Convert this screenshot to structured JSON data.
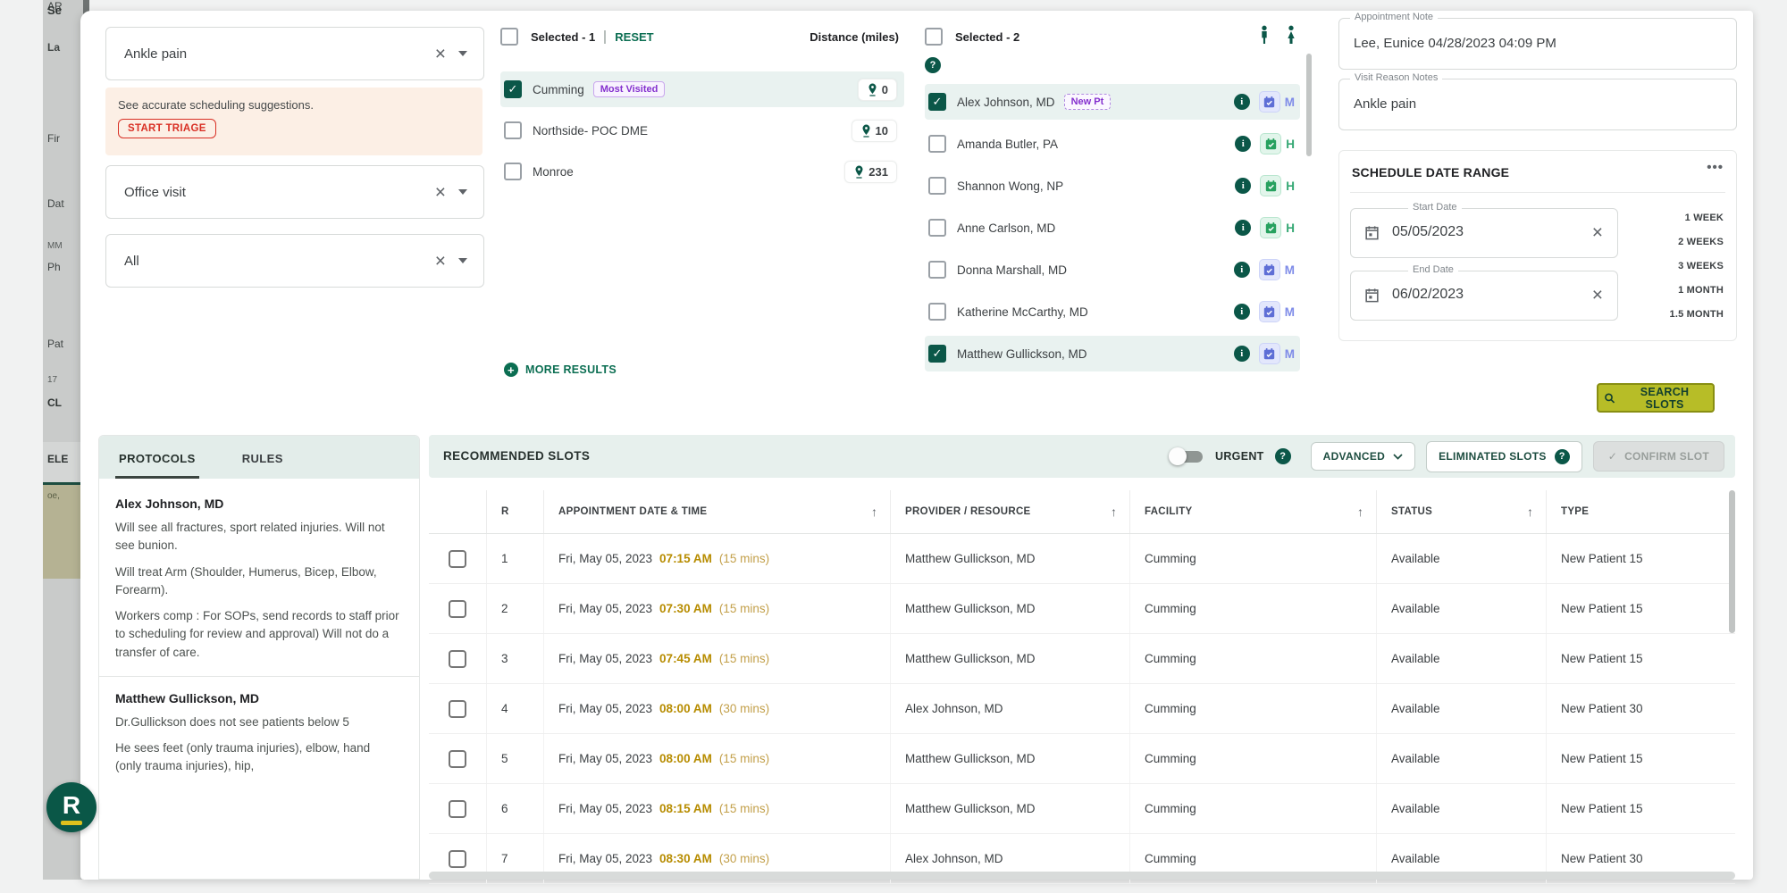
{
  "background": {
    "fragments": [
      "AR",
      "Se",
      "La",
      "Fir",
      "Dat",
      "MM",
      "Ph",
      "Pat",
      "17",
      "CL",
      "ELE",
      "oe,"
    ]
  },
  "filters": {
    "visit_reason": "Ankle pain",
    "appointment_type": "Office visit",
    "provider_filter": "All",
    "triage_notice": "See accurate scheduling suggestions.",
    "triage_button": "START TRIAGE"
  },
  "facilities": {
    "selected_label": "Selected - 1",
    "reset_label": "RESET",
    "distance_header": "Distance (miles)",
    "more_results": "MORE RESULTS",
    "items": [
      {
        "name": "Cumming",
        "badge": "Most Visited",
        "distance": "0",
        "state": "checked",
        "row_class": "selected"
      },
      {
        "name": "Northside- POC DME",
        "badge": "",
        "distance": "10",
        "state": "",
        "row_class": ""
      },
      {
        "name": "Monroe",
        "badge": "",
        "distance": "231",
        "state": "",
        "row_class": ""
      }
    ]
  },
  "providers": {
    "selected_label": "Selected - 2",
    "items": [
      {
        "name": "Alex Johnson, MD",
        "badge": "New Pt",
        "state": "checked",
        "row_class": "selected",
        "cal_letter": "M",
        "cal_color": "blue"
      },
      {
        "name": "Amanda Butler, PA",
        "badge": "",
        "state": "",
        "row_class": "",
        "cal_letter": "H",
        "cal_color": "green"
      },
      {
        "name": "Shannon Wong, NP",
        "badge": "",
        "state": "",
        "row_class": "",
        "cal_letter": "H",
        "cal_color": "green"
      },
      {
        "name": "Anne Carlson, MD",
        "badge": "",
        "state": "",
        "row_class": "",
        "cal_letter": "H",
        "cal_color": "green"
      },
      {
        "name": "Donna Marshall, MD",
        "badge": "",
        "state": "",
        "row_class": "",
        "cal_letter": "M",
        "cal_color": "blue"
      },
      {
        "name": "Katherine McCarthy, MD",
        "badge": "",
        "state": "",
        "row_class": "",
        "cal_letter": "M",
        "cal_color": "blue"
      },
      {
        "name": "Matthew Gullickson, MD",
        "badge": "",
        "state": "checked",
        "row_class": "selected",
        "cal_letter": "M",
        "cal_color": "blue"
      }
    ]
  },
  "notes": {
    "appointment_note_label": "Appointment Note",
    "appointment_note": "Lee, Eunice 04/28/2023 04:09 PM",
    "visit_reason_label": "Visit Reason Notes",
    "visit_reason": "Ankle pain"
  },
  "date_range": {
    "title": "SCHEDULE DATE RANGE",
    "menu_icon": "•••",
    "start_label": "Start Date",
    "start_value": "05/05/2023",
    "end_label": "End Date",
    "end_value": "06/02/2023",
    "quick_options": [
      "1 WEEK",
      "2 WEEKS",
      "3 WEEKS",
      "1 MONTH",
      "1.5 MONTH"
    ]
  },
  "search_button": "SEARCH SLOTS",
  "protocols": {
    "tabs": [
      "PROTOCOLS",
      "RULES"
    ],
    "blocks": [
      {
        "type": "title",
        "text": "Alex Johnson, MD"
      },
      {
        "type": "para",
        "text": "Will see all fractures, sport related injuries. Will not see bunion."
      },
      {
        "type": "para",
        "text": "Will treat Arm (Shoulder, Humerus, Bicep, Elbow, Forearm)."
      },
      {
        "type": "para",
        "text": "Workers comp : For SOPs, send records to staff prior to scheduling for review and approval) Will not do a transfer of care."
      },
      {
        "type": "divider",
        "text": ""
      },
      {
        "type": "title",
        "text": "Matthew Gullickson, MD"
      },
      {
        "type": "para",
        "text": "Dr.Gullickson does not see patients below 5"
      },
      {
        "type": "para",
        "text": "He sees feet (only trauma injuries), elbow, hand (only trauma injuries), hip,"
      }
    ]
  },
  "slots": {
    "title": "RECOMMENDED SLOTS",
    "urgent_label": "URGENT",
    "advanced_label": "ADVANCED",
    "eliminated_label": "ELIMINATED SLOTS",
    "confirm_label": "CONFIRM SLOT",
    "columns": [
      {
        "label": "R",
        "key": "col-r",
        "sortable": false
      },
      {
        "label": "APPOINTMENT DATE & TIME",
        "key": "col-date",
        "sortable": true
      },
      {
        "label": "PROVIDER / RESOURCE",
        "key": "col-provider",
        "sortable": true
      },
      {
        "label": "FACILITY",
        "key": "col-facility",
        "sortable": true
      },
      {
        "label": "STATUS",
        "key": "col-status",
        "sortable": true
      },
      {
        "label": "TYPE",
        "key": "col-type",
        "sortable": false
      }
    ],
    "rows": [
      {
        "r": "1",
        "date": "Fri, May 05, 2023",
        "time": "07:15 AM",
        "duration": "(15 mins)",
        "provider": "Matthew Gullickson, MD",
        "facility": "Cumming",
        "status": "Available",
        "type": "New Patient 15"
      },
      {
        "r": "2",
        "date": "Fri, May 05, 2023",
        "time": "07:30 AM",
        "duration": "(15 mins)",
        "provider": "Matthew Gullickson, MD",
        "facility": "Cumming",
        "status": "Available",
        "type": "New Patient 15"
      },
      {
        "r": "3",
        "date": "Fri, May 05, 2023",
        "time": "07:45 AM",
        "duration": "(15 mins)",
        "provider": "Matthew Gullickson, MD",
        "facility": "Cumming",
        "status": "Available",
        "type": "New Patient 15"
      },
      {
        "r": "4",
        "date": "Fri, May 05, 2023",
        "time": "08:00 AM",
        "duration": "(30 mins)",
        "provider": "Alex Johnson, MD",
        "facility": "Cumming",
        "status": "Available",
        "type": "New Patient 30"
      },
      {
        "r": "5",
        "date": "Fri, May 05, 2023",
        "time": "08:00 AM",
        "duration": "(15 mins)",
        "provider": "Matthew Gullickson, MD",
        "facility": "Cumming",
        "status": "Available",
        "type": "New Patient 15"
      },
      {
        "r": "6",
        "date": "Fri, May 05, 2023",
        "time": "08:15 AM",
        "duration": "(15 mins)",
        "provider": "Matthew Gullickson, MD",
        "facility": "Cumming",
        "status": "Available",
        "type": "New Patient 15"
      },
      {
        "r": "7",
        "date": "Fri, May 05, 2023",
        "time": "08:30 AM",
        "duration": "(30 mins)",
        "provider": "Alex Johnson, MD",
        "facility": "Cumming",
        "status": "Available",
        "type": "New Patient 30"
      }
    ]
  },
  "logo": "R",
  "colors": {
    "primary_green": "#0B5748",
    "accent_olive": "#B7BD27",
    "alert_red": "#D93025",
    "badge_purple": "#8430CE",
    "time_amber": "#B78C00",
    "chip_blue": "#6B79E0",
    "chip_green": "#2AA568",
    "header_teal": "#E7F0ED"
  }
}
